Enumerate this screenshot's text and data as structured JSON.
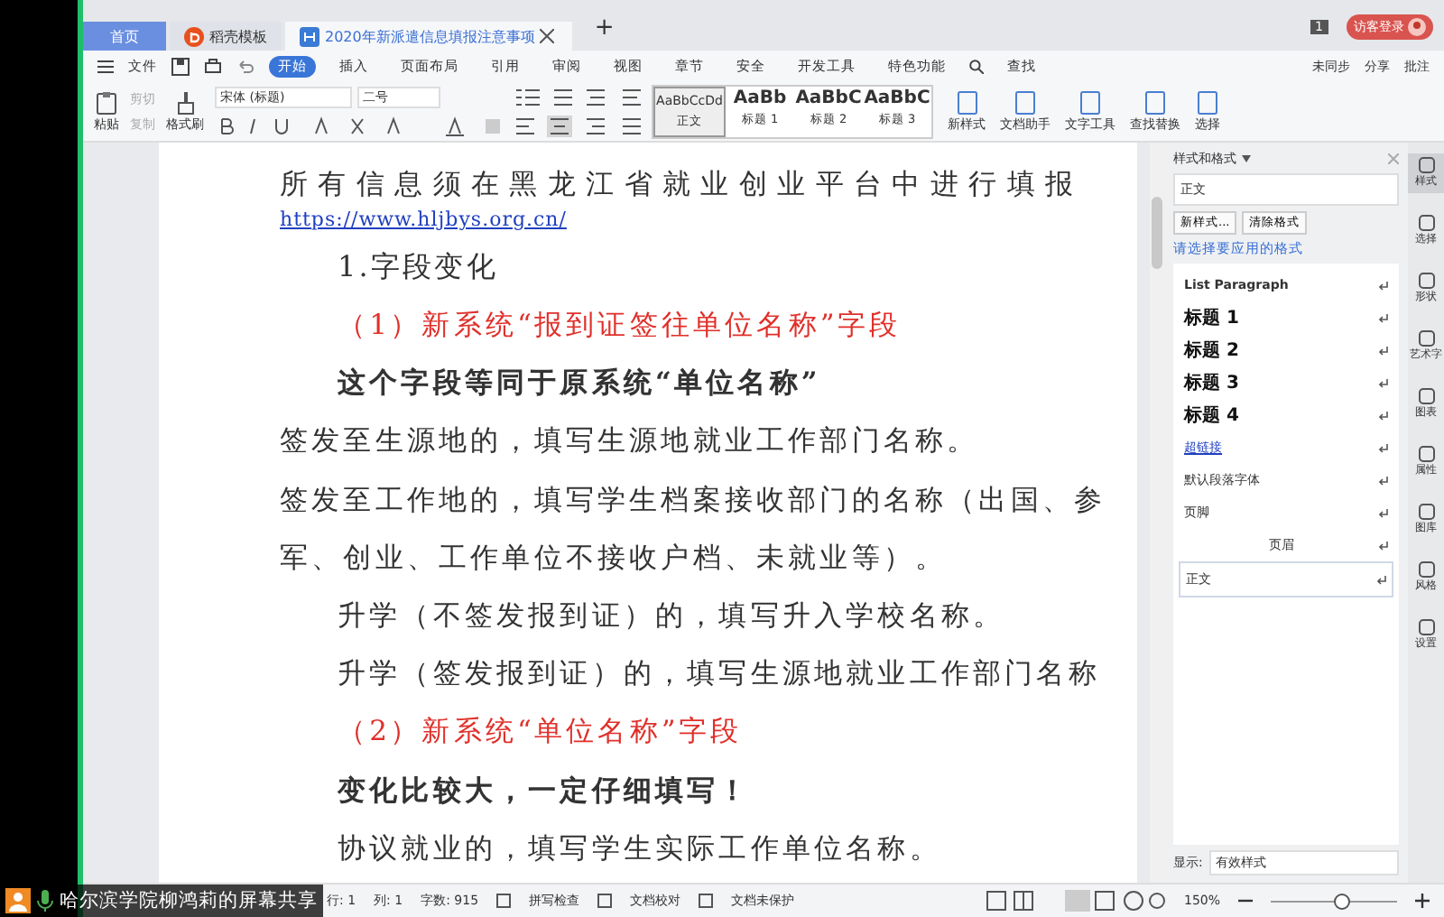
{
  "tabs": [
    {
      "label": "首页",
      "kind": "home",
      "selected": false
    },
    {
      "label": "稻壳模板",
      "kind": "template",
      "selected": false
    },
    {
      "label": "2020年新派遣信息填报注意事项",
      "kind": "doc",
      "selected": true
    }
  ],
  "new_tab": "+",
  "notification_count": "1",
  "login_button": "访客登录",
  "menu": {
    "file": "文件",
    "items": [
      {
        "label": "开始",
        "selected": true
      },
      {
        "label": "插入",
        "selected": false
      },
      {
        "label": "页面布局",
        "selected": false
      },
      {
        "label": "引用",
        "selected": false
      },
      {
        "label": "审阅",
        "selected": false
      },
      {
        "label": "视图",
        "selected": false
      },
      {
        "label": "章节",
        "selected": false
      },
      {
        "label": "安全",
        "selected": false
      },
      {
        "label": "开发工具",
        "selected": false
      },
      {
        "label": "特色功能",
        "selected": false
      }
    ],
    "search": "查找",
    "right": [
      "未同步",
      "分享",
      "批注"
    ]
  },
  "ribbon": {
    "paste": "粘贴",
    "cut": "剪切",
    "copy": "复制",
    "format_painter": "格式刷",
    "font": "宋体 (标题)",
    "size": "二号",
    "styles": [
      {
        "sample": "AaBbCcDd",
        "label": "正文",
        "selected": true
      },
      {
        "sample": "AaBb",
        "label": "标题 1",
        "selected": false
      },
      {
        "sample": "AaBbC",
        "label": "标题 2",
        "selected": false
      },
      {
        "sample": "AaBbC",
        "label": "标题 3",
        "selected": false
      }
    ],
    "tools": [
      "新样式",
      "文档助手",
      "文字工具",
      "查找替换",
      "选择"
    ]
  },
  "document": [
    {
      "kind": "justified",
      "text": "所有信息须在黑龙江省就业创业平台中进行填报"
    },
    {
      "kind": "link",
      "text": "https://www.hljbys.org.cn/"
    },
    {
      "kind": "heading",
      "text": "1.字段变化"
    },
    {
      "kind": "red",
      "text": "（1）新系统“报到证签往单位名称”字段"
    },
    {
      "kind": "bold",
      "text": "这个字段等同于原系统“单位名称”"
    },
    {
      "kind": "body",
      "text": "签发至生源地的，填写生源地就业工作部门名称。"
    },
    {
      "kind": "body",
      "text": "签发至工作地的，填写学生档案接收部门的名称（出国、参"
    },
    {
      "kind": "body",
      "text": "军、创业、工作单位不接收户档、未就业等）。"
    },
    {
      "kind": "indent",
      "text": "升学（不签发报到证）的，填写升入学校名称。"
    },
    {
      "kind": "indent",
      "text": "升学（签发报到证）的，填写生源地就业工作部门名称"
    },
    {
      "kind": "red",
      "text": "（2）新系统“单位名称”字段"
    },
    {
      "kind": "bold",
      "text": "变化比较大，一定仔细填写！"
    },
    {
      "kind": "indent",
      "text": "协议就业的，填写学生实际工作单位名称。"
    }
  ],
  "styles_panel": {
    "title": "样式和格式",
    "current": "正文",
    "buttons": [
      "新样式...",
      "清除格式"
    ],
    "prompt": "请选择要应用的格式",
    "items": [
      {
        "kind": "list",
        "label": "List Paragraph",
        "selected": false
      },
      {
        "kind": "heading",
        "label": "标题 1",
        "selected": false
      },
      {
        "kind": "heading",
        "label": "标题 2",
        "selected": false
      },
      {
        "kind": "heading",
        "label": "标题 3",
        "selected": false
      },
      {
        "kind": "heading",
        "label": "标题 4",
        "selected": false
      },
      {
        "kind": "link",
        "label": "超链接",
        "selected": false
      },
      {
        "kind": "char",
        "label": "默认段落字体",
        "selected": false
      },
      {
        "kind": "plain",
        "label": "页脚",
        "selected": false
      },
      {
        "kind": "center",
        "label": "页眉",
        "selected": false
      },
      {
        "kind": "plain",
        "label": "正文",
        "selected": true
      }
    ],
    "show_label": "显示:",
    "show_value": "有效样式"
  },
  "side_tools": [
    {
      "label": "样式",
      "selected": true
    },
    {
      "label": "选择",
      "selected": false
    },
    {
      "label": "形状",
      "selected": false
    },
    {
      "label": "艺术字",
      "selected": false
    },
    {
      "label": "图表",
      "selected": false
    },
    {
      "label": "属性",
      "selected": false
    },
    {
      "label": "图库",
      "selected": false
    },
    {
      "label": "风格",
      "selected": false
    },
    {
      "label": "设置",
      "selected": false
    }
  ],
  "status": {
    "items": [
      "行: 1",
      "列: 1",
      "字数: 915"
    ],
    "tools": [
      "拼写检查",
      "文档校对",
      "文档未保护"
    ],
    "zoom": "150%",
    "zoom_slider": {
      "level": 0.55
    }
  },
  "share_overlay": "哈尔滨学院柳鸿莉的屏幕共享"
}
